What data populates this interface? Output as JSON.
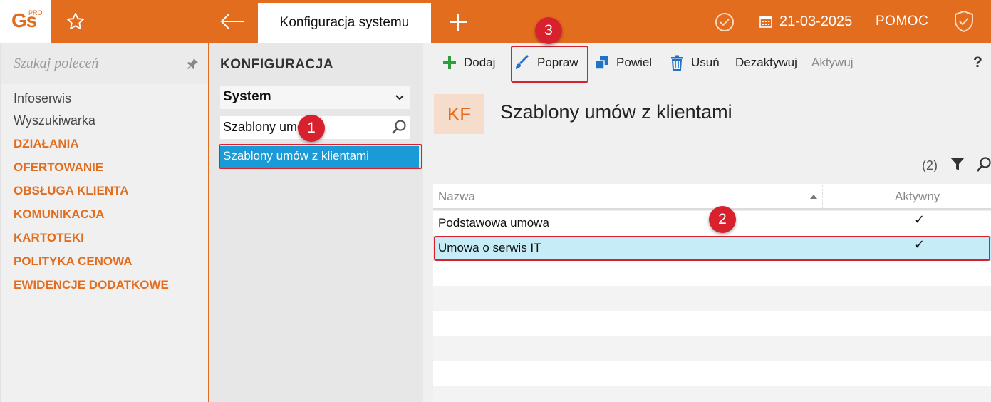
{
  "app": {
    "logo_text": "Gs",
    "logo_pro": "PRO",
    "active_tab": "Konfiguracja systemu",
    "date": "21-03-2025",
    "help_label": "POMOC"
  },
  "sidebar": {
    "search_placeholder": "Szukaj poleceń",
    "links": [
      "Infoserwis",
      "Wyszukiwarka"
    ],
    "categories": [
      "DZIAŁANIA",
      "OFERTOWANIE",
      "OBSŁUGA KLIENTA",
      "KOMUNIKACJA",
      "KARTOTEKI",
      "POLITYKA CENOWA",
      "EWIDENCJE DODATKOWE"
    ]
  },
  "config_panel": {
    "title": "KONFIGURACJA",
    "selected_group": "System",
    "search_value": "Szablony umów z",
    "result": "Szablony umów z klientami"
  },
  "toolbar": {
    "add": "Dodaj",
    "edit": "Popraw",
    "duplicate": "Powiel",
    "delete": "Usuń",
    "deactivate": "Dezaktywuj",
    "activate": "Aktywuj",
    "help": "?"
  },
  "view": {
    "badge": "KF",
    "title": "Szablony umów z klientami",
    "count": "(2)"
  },
  "table": {
    "col_name": "Nazwa",
    "col_active": "Aktywny",
    "rows": [
      {
        "name": "Podstawowa umowa",
        "active": "✓"
      },
      {
        "name": "Umowa o serwis IT",
        "active": "✓"
      }
    ]
  },
  "callouts": [
    "1",
    "2",
    "3"
  ],
  "colors": {
    "accent": "#e36d1e",
    "selection_blue": "#1a9ad6",
    "row_selected": "#c6ecf7",
    "callout_red": "#d9212e"
  }
}
